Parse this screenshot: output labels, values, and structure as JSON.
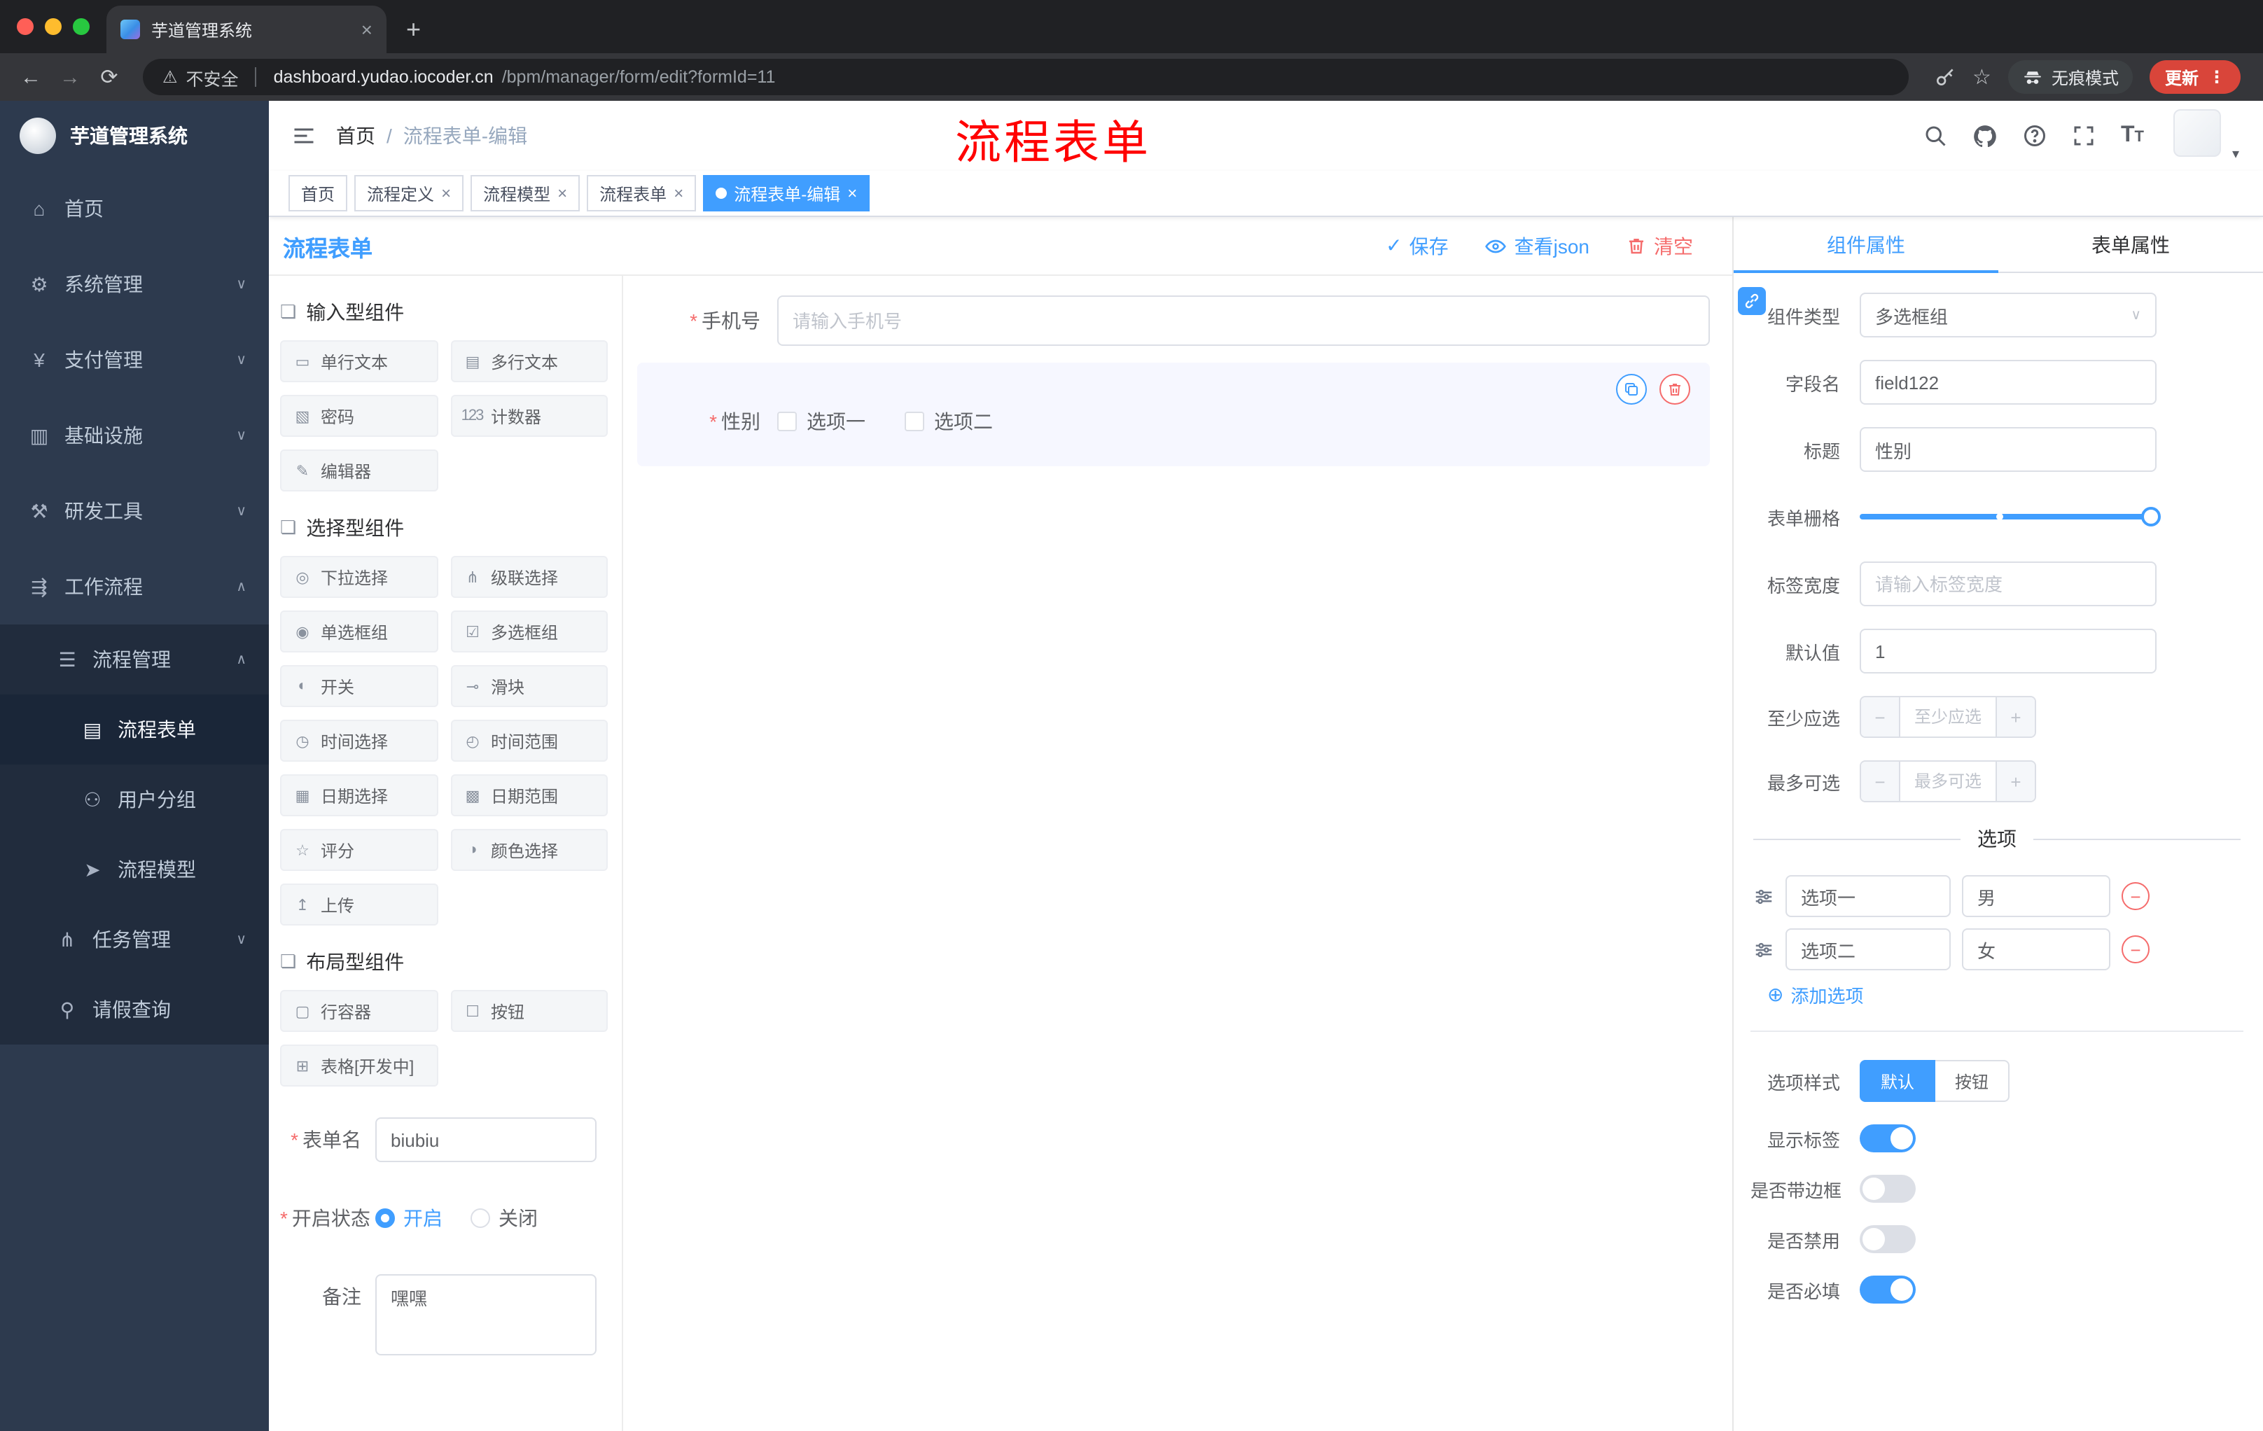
{
  "icons": {
    "close": "×",
    "new_tab": "+",
    "back": "←",
    "forward": "→",
    "reload": "⟳",
    "warning": "⚠",
    "star": "☆",
    "menu_dots": "⋮",
    "check": "✓",
    "chevron_down": "∨",
    "chevron_up": "∧",
    "caret_down": "▾",
    "minus": "−",
    "plus": "+",
    "circle_plus": "⊕",
    "required": "*",
    "breadcrumb_sep": "/"
  },
  "browser": {
    "tab_title": "芋道管理系统",
    "security_label": "不安全",
    "url_host": "dashboard.yudao.iocoder.cn",
    "url_path": "/bpm/manager/form/edit?formId=11",
    "incognito_label": "无痕模式",
    "update_label": "更新"
  },
  "sidebar": {
    "logo_title": "芋道管理系统",
    "items": [
      {
        "label": "首页",
        "icon": "⌂"
      },
      {
        "label": "系统管理",
        "icon": "⚙"
      },
      {
        "label": "支付管理",
        "icon": "¥"
      },
      {
        "label": "基础设施",
        "icon": "▥"
      },
      {
        "label": "研发工具",
        "icon": "⚒"
      },
      {
        "label": "工作流程",
        "icon": "⇶"
      },
      {
        "label": "流程管理",
        "icon": "☰"
      },
      {
        "label": "流程表单",
        "icon": "▤"
      },
      {
        "label": "用户分组",
        "icon": "⚇"
      },
      {
        "label": "流程模型",
        "icon": "➤"
      },
      {
        "label": "任务管理",
        "icon": "⋔"
      },
      {
        "label": "请假查询",
        "icon": "⚲"
      }
    ]
  },
  "header": {
    "breadcrumb_home": "首页",
    "breadcrumb_current": "流程表单-编辑",
    "annotation": "流程表单"
  },
  "tags": [
    {
      "label": "首页"
    },
    {
      "label": "流程定义"
    },
    {
      "label": "流程模型"
    },
    {
      "label": "流程表单"
    },
    {
      "label": "流程表单-编辑"
    }
  ],
  "designer": {
    "title": "流程表单",
    "save_label": "保存",
    "view_json_label": "查看json",
    "clear_label": "清空",
    "palette": {
      "groups": [
        {
          "title": "输入型组件",
          "items": [
            {
              "label": "单行文本",
              "icon": "▭"
            },
            {
              "label": "多行文本",
              "icon": "▤"
            },
            {
              "label": "密码",
              "icon": "▧"
            },
            {
              "label": "计数器",
              "icon": "123"
            },
            {
              "label": "编辑器",
              "icon": "✎"
            }
          ]
        },
        {
          "title": "选择型组件",
          "items": [
            {
              "label": "下拉选择",
              "icon": "◎"
            },
            {
              "label": "级联选择",
              "icon": "⋔"
            },
            {
              "label": "单选框组",
              "icon": "◉"
            },
            {
              "label": "多选框组",
              "icon": "☑"
            },
            {
              "label": "开关",
              "icon": "◐"
            },
            {
              "label": "滑块",
              "icon": "⊸"
            },
            {
              "label": "时间选择",
              "icon": "◷"
            },
            {
              "label": "时间范围",
              "icon": "◴"
            },
            {
              "label": "日期选择",
              "icon": "▦"
            },
            {
              "label": "日期范围",
              "icon": "▩"
            },
            {
              "label": "评分",
              "icon": "☆"
            },
            {
              "label": "颜色选择",
              "icon": "◑"
            },
            {
              "label": "上传",
              "icon": "↥"
            }
          ]
        },
        {
          "title": "布局型组件",
          "items": [
            {
              "label": "行容器",
              "icon": "▢"
            },
            {
              "label": "按钮",
              "icon": "☐"
            },
            {
              "label": "表格[开发中]",
              "icon": "⊞"
            }
          ]
        }
      ]
    },
    "meta": {
      "form_name_label": "表单名",
      "form_name_value": "biubiu",
      "status_label": "开启状态",
      "status_on": "开启",
      "status_off": "关闭",
      "remark_label": "备注",
      "remark_value": "嘿嘿"
    },
    "canvas": {
      "phone_label": "手机号",
      "phone_placeholder": "请输入手机号",
      "gender_label": "性别",
      "gender_option1": "选项一",
      "gender_option2": "选项二"
    }
  },
  "props": {
    "tab_component": "组件属性",
    "tab_form": "表单属性",
    "component_type_label": "组件类型",
    "component_type_value": "多选框组",
    "field_name_label": "字段名",
    "field_name_value": "field122",
    "title_label": "标题",
    "title_value": "性别",
    "grid_label": "表单栅格",
    "label_width_label": "标签宽度",
    "label_width_placeholder": "请输入标签宽度",
    "default_label": "默认值",
    "default_value": "1",
    "min_label": "至少应选",
    "min_placeholder": "至少应选",
    "max_label": "最多可选",
    "max_placeholder": "最多可选",
    "options_title": "选项",
    "options": [
      {
        "label": "选项一",
        "value": "男"
      },
      {
        "label": "选项二",
        "value": "女"
      }
    ],
    "add_option_label": "添加选项",
    "style_label": "选项样式",
    "style_default": "默认",
    "style_button": "按钮",
    "show_label_label": "显示标签",
    "border_label": "是否带边框",
    "disabled_label": "是否禁用",
    "required_label": "是否必填"
  },
  "colors": {
    "primary": "#409EFF",
    "danger": "#F56C6C",
    "annotation": "#FF0000"
  }
}
